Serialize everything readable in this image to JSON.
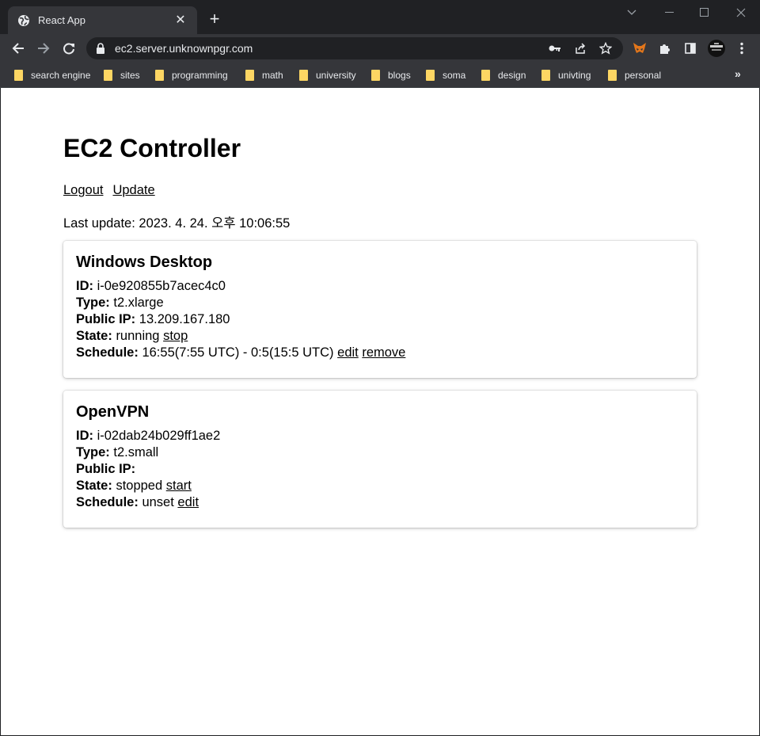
{
  "browser": {
    "tab_title": "React App",
    "tab_close": "✕",
    "new_tab": "+",
    "url": "ec2.server.unknownpgr.com",
    "bookmarks": [
      {
        "label": "search engine"
      },
      {
        "label": "sites"
      },
      {
        "label": "programming"
      },
      {
        "label": "math"
      },
      {
        "label": "university"
      },
      {
        "label": "blogs"
      },
      {
        "label": "soma"
      },
      {
        "label": "design"
      },
      {
        "label": "univting"
      },
      {
        "label": "personal"
      }
    ],
    "bookmarks_more": "»",
    "colors": {
      "frame": "#202124",
      "toolbar": "#35363a",
      "folder": "#fdd663",
      "text": "#e8eaed"
    }
  },
  "page": {
    "title": "EC2 Controller",
    "logout_label": "Logout",
    "update_label": "Update",
    "last_update": "Last update: 2023. 4. 24. 오후 10:06:55",
    "instances": [
      {
        "name": "Windows Desktop",
        "id_label": "ID:",
        "id": "i-0e920855b7acec4c0",
        "type_label": "Type:",
        "type": "t2.xlarge",
        "ip_label": "Public IP:",
        "ip": "13.209.167.180",
        "state_label": "State:",
        "state": "running",
        "state_action": "stop",
        "schedule_label": "Schedule:",
        "schedule": "16:55(7:55 UTC) - 0:5(15:5 UTC)",
        "edit_label": "edit",
        "remove_label": "remove"
      },
      {
        "name": "OpenVPN",
        "id_label": "ID:",
        "id": "i-02dab24b029ff1ae2",
        "type_label": "Type:",
        "type": "t2.small",
        "ip_label": "Public IP:",
        "ip": "",
        "state_label": "State:",
        "state": "stopped",
        "state_action": "start",
        "schedule_label": "Schedule:",
        "schedule": "unset",
        "edit_label": "edit"
      }
    ]
  }
}
